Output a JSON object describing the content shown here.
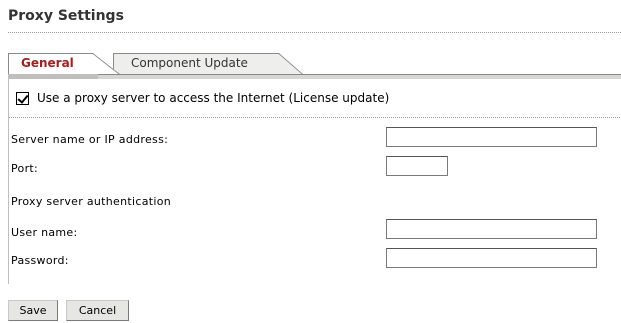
{
  "page": {
    "title": "Proxy Settings"
  },
  "tabs": [
    {
      "label": "General",
      "active": true
    },
    {
      "label": "Component Update",
      "active": false
    }
  ],
  "proxy": {
    "use_proxy_label": "Use a proxy server to access the Internet (License update)",
    "use_proxy_checked": true
  },
  "fields": {
    "server_label": "Server name or IP address:",
    "server_value": "",
    "port_label": "Port:",
    "port_value": "",
    "auth_heading": "Proxy server authentication",
    "username_label": "User name:",
    "username_value": "",
    "password_label": "Password:",
    "password_value": ""
  },
  "buttons": {
    "save": "Save",
    "cancel": "Cancel"
  },
  "colors": {
    "active_tab_text": "#a81c1c",
    "tab_strip": "#d6d6d2"
  }
}
